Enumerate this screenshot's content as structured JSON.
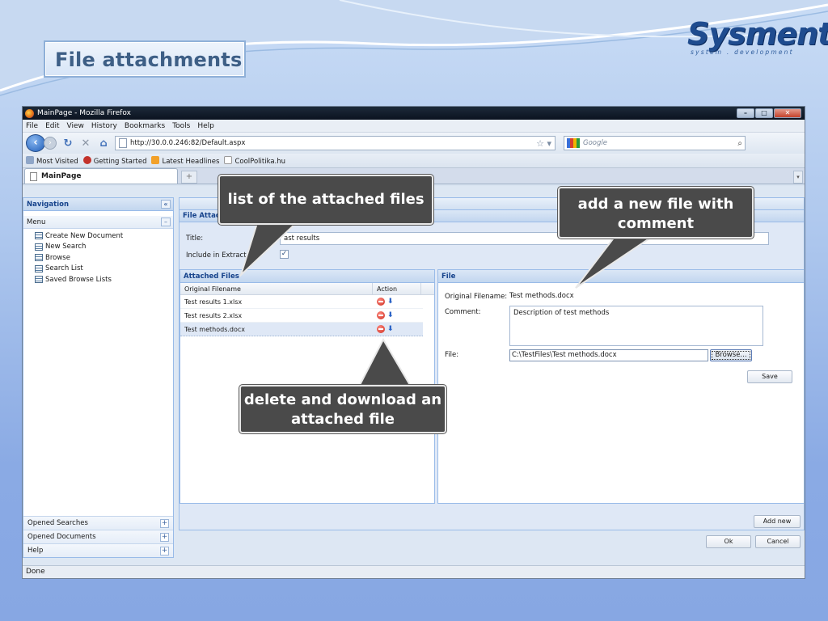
{
  "slide": {
    "title": "File attachments",
    "logo_name": "Sysment",
    "logo_tagline": "system . development"
  },
  "browser": {
    "window_title": "MainPage - Mozilla Firefox",
    "menu": [
      "File",
      "Edit",
      "View",
      "History",
      "Bookmarks",
      "Tools",
      "Help"
    ],
    "url": "http://30.0.0.246:82/Default.aspx",
    "search_placeholder": "Google",
    "bookmarks": [
      "Most Visited",
      "Getting Started",
      "Latest Headlines",
      "CoolPolitika.hu"
    ],
    "tab_label": "MainPage",
    "new_tab_symbol": "+",
    "status": "Done"
  },
  "sidebar": {
    "header": "Navigation",
    "menu_label": "Menu",
    "items": [
      "Create New Document",
      "New Search",
      "Browse",
      "Search List",
      "Saved Browse Lists"
    ],
    "footer": [
      "Opened Searches",
      "Opened Documents",
      "Help"
    ]
  },
  "form": {
    "panel_title": "File Attach",
    "title_label": "Title:",
    "title_value": "ast results",
    "include_label": "Include in Extract",
    "include_checked": true
  },
  "attached_files": {
    "header": "Attached Files",
    "columns": [
      "Original Filename",
      "Action"
    ],
    "rows": [
      "Test results 1.xlsx",
      "Test results 2.xlsx",
      "Test methods.docx"
    ],
    "selected_index": 2
  },
  "file_panel": {
    "header": "File",
    "original_filename_label": "Original Filename:",
    "original_filename_value": "Test methods.docx",
    "comment_label": "Comment:",
    "comment_value": "Description of test methods",
    "file_label": "File:",
    "file_value": "C:\\TestFiles\\Test methods.docx",
    "browse_label": "Browse...",
    "save_label": "Save"
  },
  "buttons": {
    "add_new": "Add new",
    "ok": "Ok",
    "cancel": "Cancel"
  },
  "callouts": {
    "list": "list of the attached files",
    "add": "add a new file with comment",
    "delete": "delete and download an attached file"
  }
}
